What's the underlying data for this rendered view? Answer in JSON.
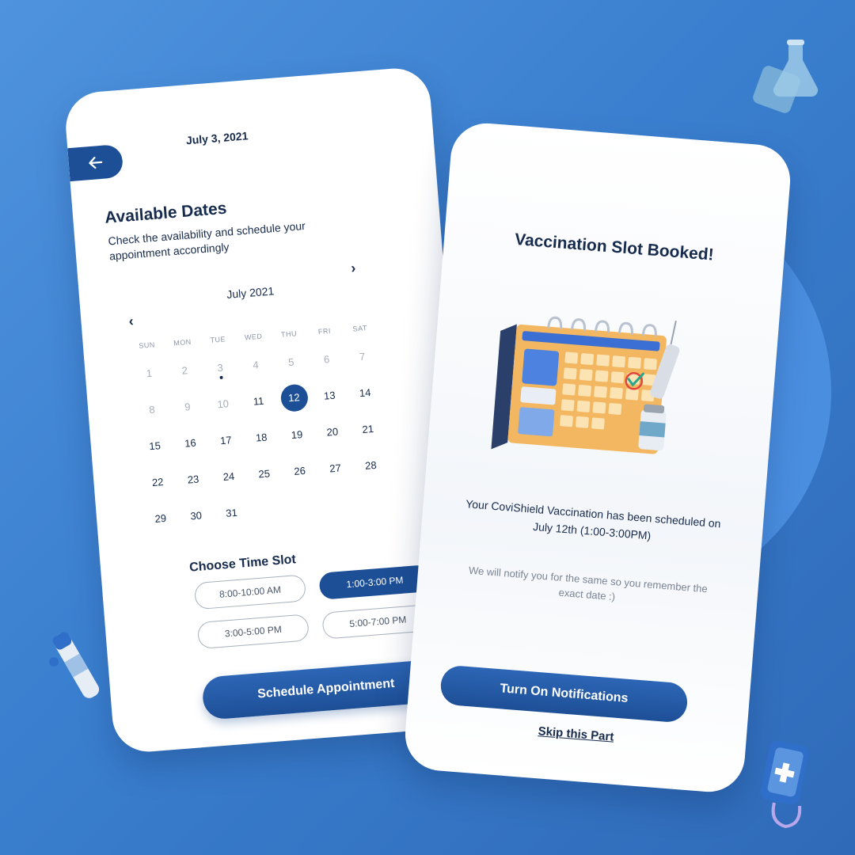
{
  "left_screen": {
    "header_date": "July 3, 2021",
    "title": "Available Dates",
    "subtitle": "Check the availability and schedule your appointment accordingly",
    "calendar": {
      "month": "July 2021",
      "weekdays": [
        "SUN",
        "MON",
        "TUE",
        "WED",
        "THU",
        "FRI",
        "SAT"
      ],
      "weeks": [
        [
          "1",
          "2",
          "3",
          "4",
          "5",
          "6",
          "7"
        ],
        [
          "8",
          "9",
          "10",
          "11",
          "12",
          "13",
          "14"
        ],
        [
          "15",
          "16",
          "17",
          "18",
          "19",
          "20",
          "21"
        ],
        [
          "22",
          "23",
          "24",
          "25",
          "26",
          "27",
          "28"
        ],
        [
          "29",
          "30",
          "31",
          "",
          "",
          "",
          ""
        ]
      ],
      "selected_day": "12",
      "today": "3"
    },
    "slot_section_title": "Choose Time Slot",
    "slots": [
      "8:00-10:00 AM",
      "1:00-3:00 PM",
      "3:00-5:00 PM",
      "5:00-7:00 PM"
    ],
    "active_slot": "1:00-3:00 PM",
    "cta": "Schedule Appointment"
  },
  "right_screen": {
    "title": "Vaccination Slot Booked!",
    "message": "Your CoviShield Vaccination has been scheduled on July 12th (1:00-3:00PM)",
    "note": "We will notify you for the same so you remember the exact date :)",
    "cta": "Turn On Notifications",
    "skip": "Skip this Part"
  },
  "colors": {
    "primary": "#1d4f96",
    "text": "#172b4d",
    "background": "#3a7fcf"
  },
  "icons": [
    "back-arrow-icon",
    "chevron-left-icon",
    "chevron-right-icon",
    "calendar-illustration",
    "syringe-illustration",
    "vial-illustration",
    "flask-icon",
    "test-tube-icon",
    "phone-medical-icon"
  ]
}
